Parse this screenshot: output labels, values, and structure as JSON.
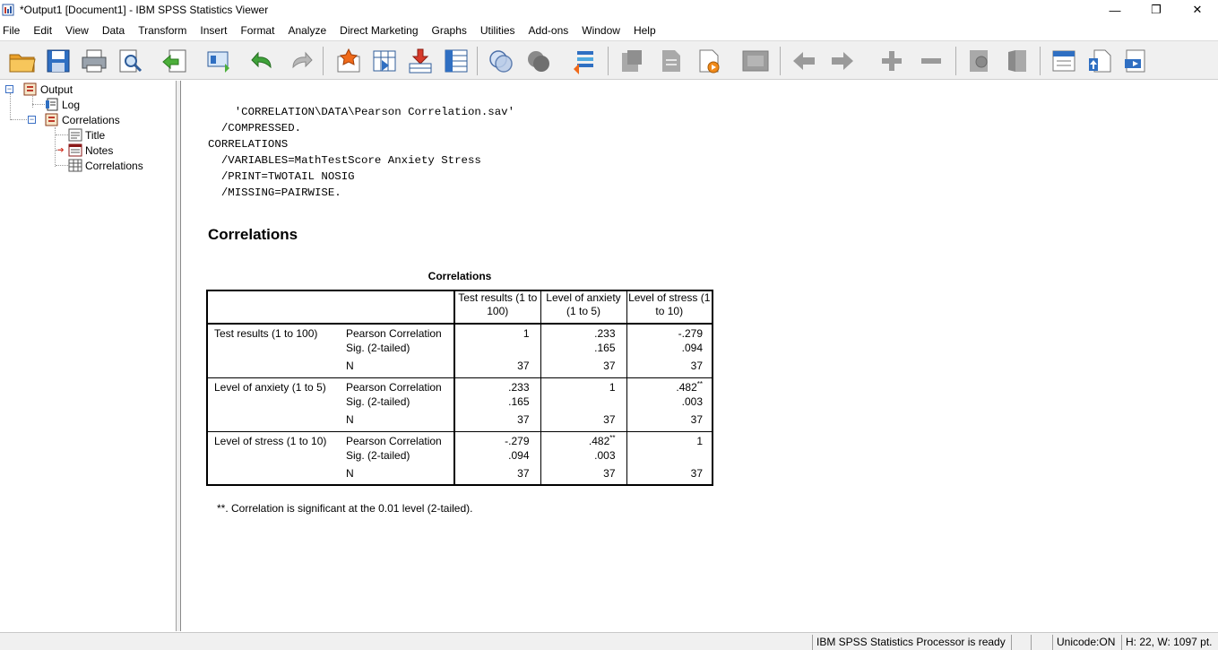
{
  "window": {
    "title": "*Output1 [Document1] - IBM SPSS Statistics Viewer",
    "controls": {
      "minimize": "—",
      "maximize": "❐",
      "close": "✕"
    }
  },
  "menu": [
    "File",
    "Edit",
    "View",
    "Data",
    "Transform",
    "Insert",
    "Format",
    "Analyze",
    "Direct Marketing",
    "Graphs",
    "Utilities",
    "Add-ons",
    "Window",
    "Help"
  ],
  "toolbar": {
    "buttons": [
      "open-icon",
      "save-icon",
      "print-icon",
      "print-preview-icon",
      "export-icon",
      "recall-dialog-icon",
      "undo-icon",
      "redo-icon",
      "goto-case-icon",
      "goto-variable-icon",
      "insert-cases-icon",
      "variables-icon",
      "designate-window-icon",
      "select-output-icon",
      "show-all-variables-icon",
      "promote-icon",
      "demote-icon",
      "page-layout-icon",
      "insert-heading-icon",
      "previous-icon",
      "next-icon",
      "expand-icon",
      "collapse-icon",
      "show-icon",
      "hide-icon",
      "insert-title-icon",
      "insert-text-icon",
      "insert-text-file-icon"
    ]
  },
  "outline": {
    "items": [
      {
        "label": "Output",
        "icon": "output-book-icon"
      },
      {
        "label": "Log",
        "icon": "log-icon"
      },
      {
        "label": "Correlations",
        "icon": "procedure-book-icon"
      },
      {
        "label": "Title",
        "icon": "title-icon"
      },
      {
        "label": "Notes",
        "icon": "notes-icon"
      },
      {
        "label": "Correlations",
        "icon": "table-icon"
      }
    ]
  },
  "output": {
    "syntax": [
      "    'CORRELATION\\DATA\\Pearson Correlation.sav'",
      "  /COMPRESSED.",
      "CORRELATIONS",
      "  /VARIABLES=MathTestScore Anxiety Stress",
      "  /PRINT=TWOTAIL NOSIG",
      "  /MISSING=PAIRWISE."
    ],
    "heading": "Correlations",
    "table": {
      "title": "Correlations",
      "columns": [
        "Test results (1 to 100)",
        "Level of anxiety (1 to 5)",
        "Level of stress (1 to 10)"
      ],
      "stat_labels": [
        "Pearson Correlation",
        "Sig. (2-tailed)",
        "N"
      ],
      "rows": [
        {
          "label": "Test results (1 to 100)",
          "pearson": [
            "1",
            ".233",
            "-.279"
          ],
          "pearson_sup": [
            "",
            "",
            ""
          ],
          "sig": [
            "",
            ".165",
            ".094"
          ],
          "n": [
            "37",
            "37",
            "37"
          ]
        },
        {
          "label": "Level of anxiety (1 to 5)",
          "pearson": [
            ".233",
            "1",
            ".482"
          ],
          "pearson_sup": [
            "",
            "",
            "**"
          ],
          "sig": [
            ".165",
            "",
            ".003"
          ],
          "n": [
            "37",
            "37",
            "37"
          ]
        },
        {
          "label": "Level of stress (1 to 10)",
          "pearson": [
            "-.279",
            ".482",
            "1"
          ],
          "pearson_sup": [
            "",
            "**",
            ""
          ],
          "sig": [
            ".094",
            ".003",
            ""
          ],
          "n": [
            "37",
            "37",
            "37"
          ]
        }
      ],
      "footnote": "**. Correlation is significant at the 0.01 level (2-tailed)."
    }
  },
  "status": {
    "processor": "IBM SPSS Statistics Processor is ready",
    "unicode": "Unicode:ON",
    "dimensions": "H: 22, W: 1097 pt."
  }
}
